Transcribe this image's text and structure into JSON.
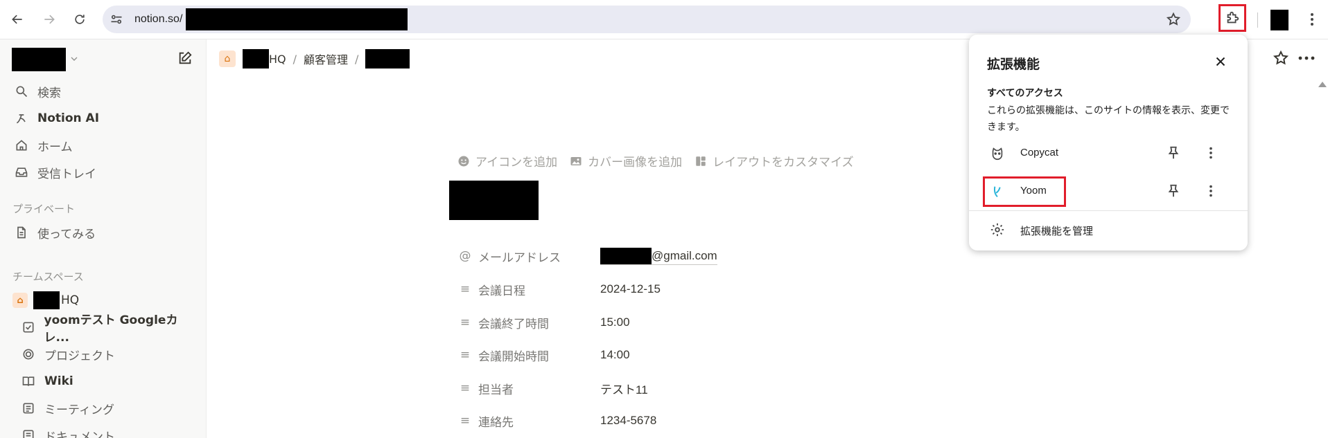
{
  "browser": {
    "url_prefix": "notion.so/",
    "colors": {
      "highlight": "#e11d2b",
      "omnibox_bg": "#e9eaf3"
    }
  },
  "sidebar": {
    "items": [
      {
        "label": "検索",
        "icon": "search-icon"
      },
      {
        "label": "Notion AI",
        "icon": "notion-ai-icon"
      },
      {
        "label": "ホーム",
        "icon": "home-icon"
      },
      {
        "label": "受信トレイ",
        "icon": "inbox-icon"
      }
    ],
    "private_section": "プライベート",
    "private_items": [
      {
        "label": "使ってみる",
        "icon": "page-icon"
      }
    ],
    "team_section": "チームスペース",
    "team_root": {
      "label_suffix": "HQ"
    },
    "team_items": [
      {
        "label": "yoomテスト Googleカレ...",
        "icon": "checkbox-icon"
      },
      {
        "label": "プロジェクト",
        "icon": "target-icon"
      },
      {
        "label": "Wiki",
        "icon": "book-icon"
      },
      {
        "label": "ミーティング",
        "icon": "document-icon"
      },
      {
        "label": "ドキュメント",
        "icon": "document-icon"
      }
    ]
  },
  "breadcrumb": {
    "root_suffix": "HQ",
    "sep": "/",
    "middle": "顧客管理"
  },
  "page": {
    "tools": {
      "add_icon": "アイコンを追加",
      "add_cover": "カバー画像を追加",
      "customize_layout": "レイアウトをカスタマイズ"
    },
    "properties": [
      {
        "icon": "@",
        "label": "メールアドレス",
        "value": "@gmail.com"
      },
      {
        "icon": "≡",
        "label": "会議日程",
        "value": "2024-12-15"
      },
      {
        "icon": "≡",
        "label": "会議終了時間",
        "value": "15:00"
      },
      {
        "icon": "≡",
        "label": "会議開始時間",
        "value": "14:00"
      },
      {
        "icon": "≡",
        "label": "担当者",
        "value": "テスト11"
      },
      {
        "icon": "≡",
        "label": "連絡先",
        "value": "1234-5678"
      }
    ]
  },
  "extensions_popup": {
    "title": "拡張機能",
    "all_access": "すべてのアクセス",
    "description": "これらの拡張機能は、このサイトの情報を表示、変更できます。",
    "extensions": [
      {
        "name": "Copycat",
        "icon": "cat-icon"
      },
      {
        "name": "Yoom",
        "icon": "yoom-icon",
        "color": "#2bb5d9"
      }
    ],
    "manage": "拡張機能を管理"
  }
}
